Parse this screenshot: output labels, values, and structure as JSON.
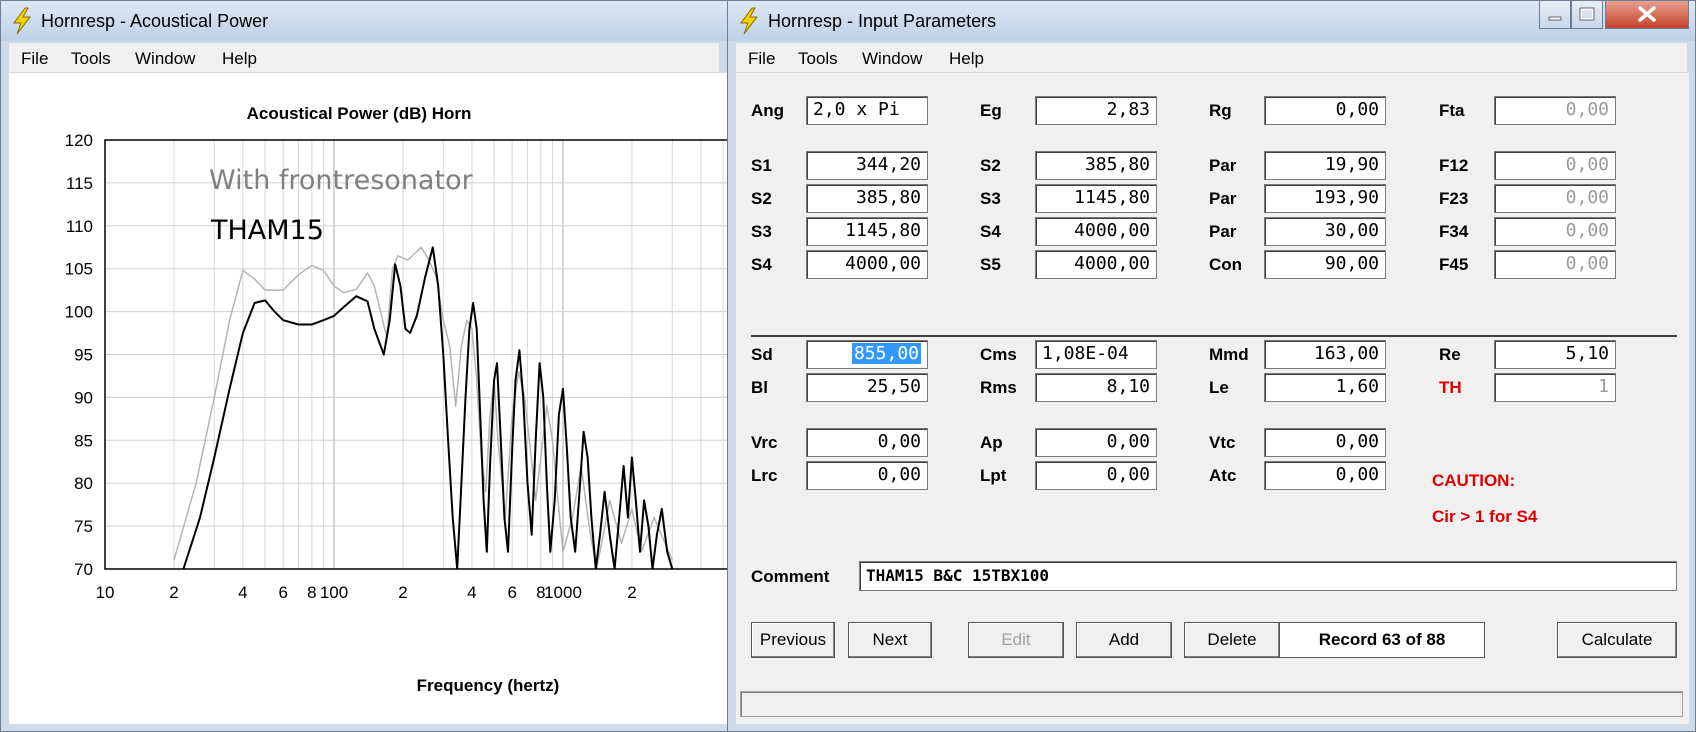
{
  "chart_window": {
    "title": "Hornresp - Acoustical Power",
    "menu": [
      "File",
      "Tools",
      "Window",
      "Help"
    ]
  },
  "chart_data": {
    "type": "line",
    "title": "Acoustical Power (dB)   Horn",
    "xlabel": "Frequency (hertz)",
    "ylabel": "",
    "x_scale": "log",
    "xlim": [
      10,
      3500
    ],
    "ylim": [
      70,
      120
    ],
    "x_tick_labels": [
      "10",
      "2",
      "4",
      "6",
      "8",
      "100",
      "2",
      "4",
      "6",
      "8",
      "1000",
      "2"
    ],
    "x_tick_values": [
      10,
      20,
      40,
      60,
      80,
      100,
      200,
      400,
      600,
      800,
      1000,
      2000
    ],
    "y_ticks": [
      70,
      75,
      80,
      85,
      90,
      95,
      100,
      105,
      110,
      115,
      120
    ],
    "grid": true,
    "annotations": [
      "With frontresonator",
      "THAM15"
    ],
    "series": [
      {
        "color": "#b4b4b4",
        "points": [
          [
            20,
            71
          ],
          [
            25,
            80
          ],
          [
            30,
            90
          ],
          [
            35,
            99
          ],
          [
            40,
            104.8
          ],
          [
            45,
            103.8
          ],
          [
            50,
            102.5
          ],
          [
            60,
            102.5
          ],
          [
            70,
            104.3
          ],
          [
            80,
            105.4
          ],
          [
            90,
            104.8
          ],
          [
            100,
            103
          ],
          [
            110,
            102.2
          ],
          [
            125,
            102.6
          ],
          [
            140,
            104.5
          ],
          [
            150,
            103
          ],
          [
            170,
            97
          ],
          [
            180,
            105
          ],
          [
            190,
            106.5
          ],
          [
            210,
            106
          ],
          [
            240,
            107.5
          ],
          [
            260,
            106
          ],
          [
            280,
            104
          ],
          [
            300,
            99
          ],
          [
            320,
            96
          ],
          [
            340,
            89
          ],
          [
            360,
            96
          ],
          [
            380,
            99
          ],
          [
            400,
            98
          ],
          [
            420,
            92
          ],
          [
            440,
            83
          ],
          [
            460,
            79
          ],
          [
            480,
            88
          ],
          [
            500,
            92
          ],
          [
            520,
            85
          ],
          [
            560,
            76
          ],
          [
            600,
            88
          ],
          [
            640,
            93
          ],
          [
            680,
            90
          ],
          [
            720,
            84
          ],
          [
            760,
            78
          ],
          [
            800,
            83
          ],
          [
            850,
            89
          ],
          [
            900,
            85
          ],
          [
            950,
            78
          ],
          [
            1000,
            72
          ],
          [
            1100,
            76
          ],
          [
            1200,
            82
          ],
          [
            1300,
            75
          ],
          [
            1400,
            70
          ],
          [
            1500,
            74
          ],
          [
            1600,
            78
          ],
          [
            1800,
            73
          ],
          [
            2000,
            77
          ],
          [
            2200,
            72
          ],
          [
            2500,
            76
          ],
          [
            3000,
            71
          ]
        ]
      },
      {
        "color": "#000000",
        "points": [
          [
            22,
            70
          ],
          [
            26,
            76
          ],
          [
            30,
            83
          ],
          [
            35,
            91
          ],
          [
            40,
            97.5
          ],
          [
            45,
            101
          ],
          [
            50,
            101.3
          ],
          [
            55,
            100
          ],
          [
            60,
            99
          ],
          [
            70,
            98.5
          ],
          [
            80,
            98.5
          ],
          [
            90,
            99
          ],
          [
            100,
            99.5
          ],
          [
            110,
            100.5
          ],
          [
            125,
            101.8
          ],
          [
            140,
            101.2
          ],
          [
            150,
            98
          ],
          [
            165,
            95
          ],
          [
            175,
            99
          ],
          [
            185,
            105.5
          ],
          [
            195,
            103
          ],
          [
            205,
            98
          ],
          [
            215,
            97.5
          ],
          [
            230,
            99.5
          ],
          [
            250,
            104
          ],
          [
            270,
            107.5
          ],
          [
            285,
            103
          ],
          [
            300,
            95
          ],
          [
            315,
            85
          ],
          [
            330,
            76
          ],
          [
            345,
            70
          ],
          [
            360,
            80
          ],
          [
            375,
            90
          ],
          [
            390,
            98
          ],
          [
            405,
            101
          ],
          [
            420,
            98
          ],
          [
            435,
            88
          ],
          [
            450,
            78
          ],
          [
            465,
            72
          ],
          [
            480,
            82
          ],
          [
            500,
            92
          ],
          [
            515,
            94
          ],
          [
            535,
            85
          ],
          [
            555,
            76
          ],
          [
            575,
            72
          ],
          [
            600,
            84
          ],
          [
            620,
            92
          ],
          [
            645,
            95.5
          ],
          [
            670,
            90
          ],
          [
            700,
            80
          ],
          [
            730,
            74
          ],
          [
            760,
            85
          ],
          [
            790,
            94
          ],
          [
            820,
            90
          ],
          [
            850,
            80
          ],
          [
            880,
            72
          ],
          [
            920,
            78
          ],
          [
            960,
            88
          ],
          [
            1000,
            91
          ],
          [
            1040,
            84
          ],
          [
            1080,
            76
          ],
          [
            1130,
            72
          ],
          [
            1180,
            79
          ],
          [
            1230,
            86
          ],
          [
            1280,
            83
          ],
          [
            1330,
            76
          ],
          [
            1390,
            70
          ],
          [
            1450,
            74
          ],
          [
            1520,
            79
          ],
          [
            1600,
            74
          ],
          [
            1680,
            70
          ],
          [
            1760,
            76
          ],
          [
            1840,
            82
          ],
          [
            1920,
            76
          ],
          [
            2000,
            83
          ],
          [
            2080,
            78
          ],
          [
            2170,
            72
          ],
          [
            2260,
            78
          ],
          [
            2360,
            75
          ],
          [
            2460,
            70
          ],
          [
            2570,
            74
          ],
          [
            2700,
            77
          ],
          [
            2850,
            72
          ],
          [
            3000,
            70
          ]
        ]
      }
    ]
  },
  "params_window": {
    "title": "Hornresp - Input Parameters",
    "menu": [
      "File",
      "Tools",
      "Window",
      "Help"
    ],
    "rows": [
      [
        [
          "Ang",
          "2,0 x Pi",
          "left",
          false
        ],
        [
          "Eg",
          "2,83",
          "right",
          false
        ],
        [
          "Rg",
          "0,00",
          "right",
          false
        ],
        [
          "Fta",
          "0,00",
          "right",
          true
        ]
      ],
      [
        [
          "S1",
          "344,20",
          "right",
          false
        ],
        [
          "S2",
          "385,80",
          "right",
          false
        ],
        [
          "Par",
          "19,90",
          "right",
          false
        ],
        [
          "F12",
          "0,00",
          "right",
          true
        ]
      ],
      [
        [
          "S2",
          "385,80",
          "right",
          false
        ],
        [
          "S3",
          "1145,80",
          "right",
          false
        ],
        [
          "Par",
          "193,90",
          "right",
          false
        ],
        [
          "F23",
          "0,00",
          "right",
          true
        ]
      ],
      [
        [
          "S3",
          "1145,80",
          "right",
          false
        ],
        [
          "S4",
          "4000,00",
          "right",
          false
        ],
        [
          "Par",
          "30,00",
          "right",
          false
        ],
        [
          "F34",
          "0,00",
          "right",
          true
        ]
      ],
      [
        [
          "S4",
          "4000,00",
          "right",
          false
        ],
        [
          "S5",
          "4000,00",
          "right",
          false
        ],
        [
          "Con",
          "90,00",
          "right",
          false
        ],
        [
          "F45",
          "0,00",
          "right",
          true
        ]
      ],
      [
        [
          "Sd",
          "855,00",
          "right",
          false
        ],
        [
          "Cms",
          "1,08E-04",
          "left",
          false
        ],
        [
          "Mmd",
          "163,00",
          "right",
          false
        ],
        [
          "Re",
          "5,10",
          "right",
          false
        ]
      ],
      [
        [
          "Bl",
          "25,50",
          "right",
          false
        ],
        [
          "Rms",
          "8,10",
          "right",
          false
        ],
        [
          "Le",
          "1,60",
          "right",
          false
        ],
        [
          "TH",
          "1",
          "right",
          true
        ]
      ],
      [
        [
          "Vrc",
          "0,00",
          "right",
          false
        ],
        [
          "Ap",
          "0,00",
          "right",
          false
        ],
        [
          "Vtc",
          "0,00",
          "right",
          false
        ]
      ],
      [
        [
          "Lrc",
          "0,00",
          "right",
          false
        ],
        [
          "Lpt",
          "0,00",
          "right",
          false
        ],
        [
          "Atc",
          "0,00",
          "right",
          false
        ]
      ]
    ],
    "caution_label": "CAUTION:",
    "caution_text": "Cir > 1 for S4",
    "comment_label": "Comment",
    "comment_value": "THAM15 B&C 15TBX100",
    "buttons": {
      "previous": "Previous",
      "next": "Next",
      "edit": "Edit",
      "add": "Add",
      "delete": "Delete",
      "calculate": "Calculate"
    },
    "record": "Record 63 of 88"
  }
}
